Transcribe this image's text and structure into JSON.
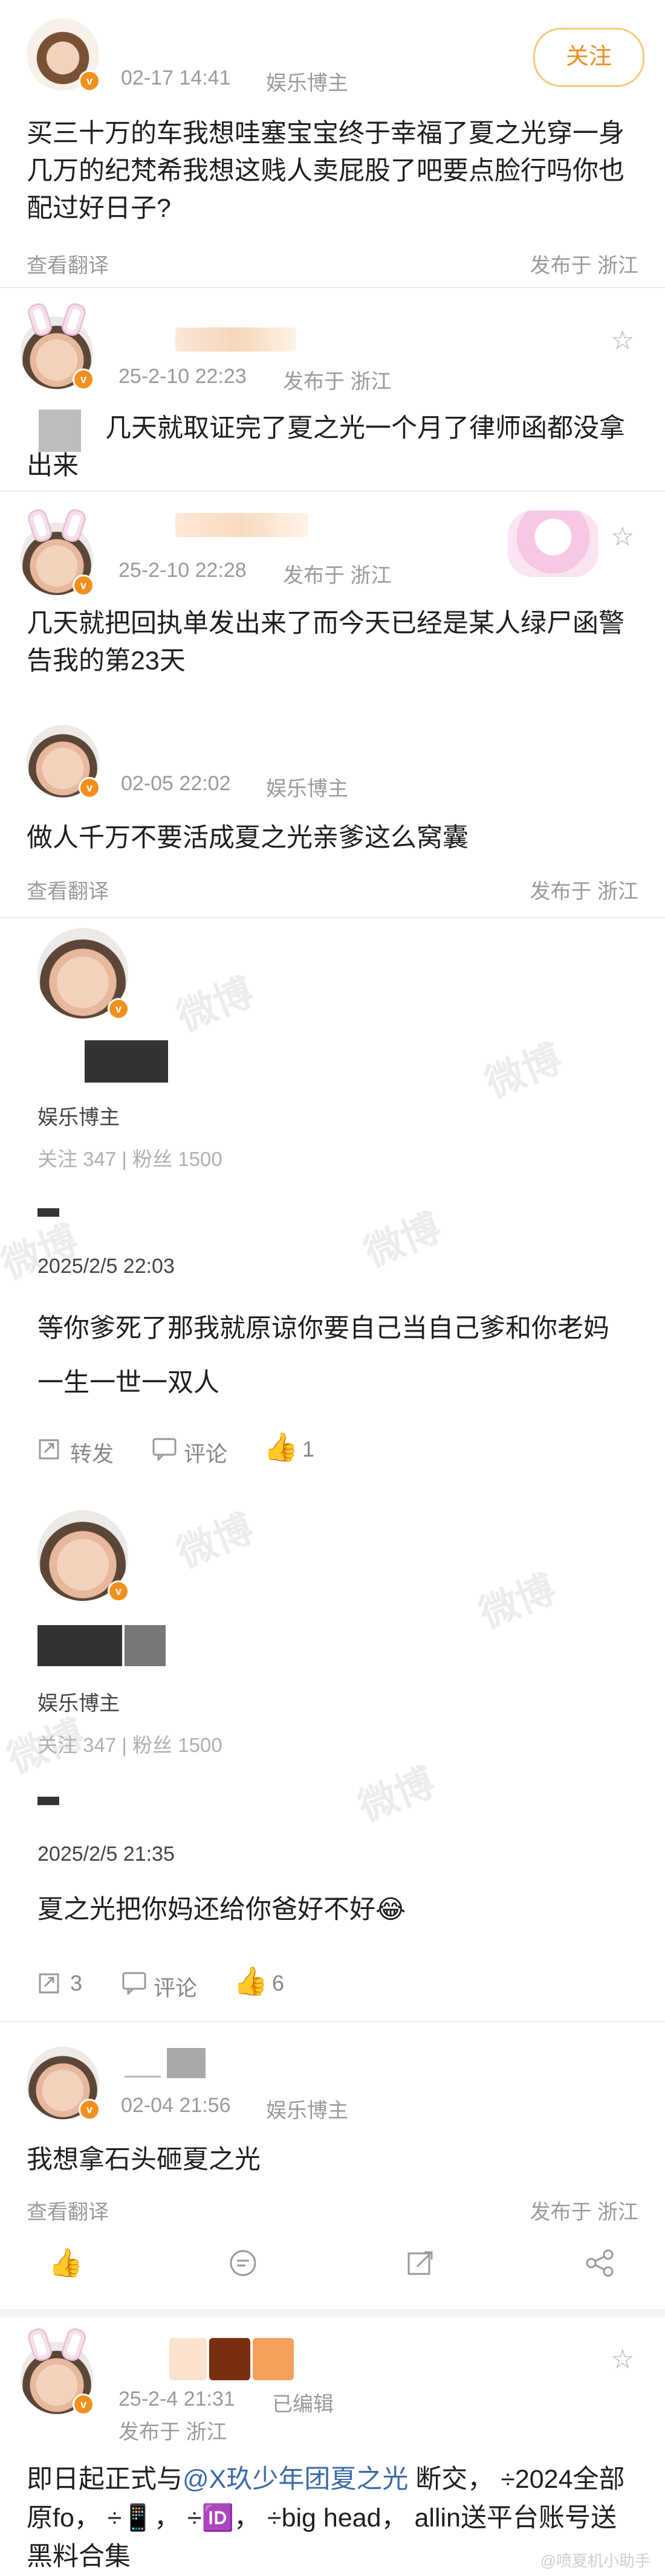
{
  "post1": {
    "time": "02-17 14:41",
    "tag": "娱乐博主",
    "follow_label": "关注",
    "text": "买三十万的车我想哇塞宝宝终于幸福了夏之光穿一身几万的纪梵希我想这贱人卖屁股了吧要点脸行吗你也配过好日子?",
    "translate": "查看翻译",
    "location": "发布于 浙江"
  },
  "reply1": {
    "time": "25-2-10 22:23",
    "location": "发布于 浙江",
    "text": "几天就取证完了夏之光一个月了律师函都没拿出来"
  },
  "reply2": {
    "time": "25-2-10 22:28",
    "location": "发布于 浙江",
    "text": "几天就把回执单发出来了而今天已经是某人绿尸函警告我的第23天"
  },
  "post2": {
    "time": "02-05 22:02",
    "tag": "娱乐博主",
    "text": "做人千万不要活成夏之光亲爹这么窝囊",
    "translate": "查看翻译",
    "location": "发布于 浙江"
  },
  "profile1": {
    "tag": "娱乐博主",
    "stats": "关注 347 | 粉丝 1500",
    "date": "2025/2/5 22:03",
    "text": "等你爹死了那我就原谅你要自己当自己爹和你老妈一生一世一双人",
    "repost": "转发",
    "comment": "评论",
    "likes": "1"
  },
  "profile2": {
    "tag": "娱乐博主",
    "stats": "关注 347 | 粉丝 1500",
    "date": "2025/2/5 21:35",
    "text": "夏之光把你妈还给你爸好不好😂",
    "reposts": "3",
    "comment": "评论",
    "likes": "6"
  },
  "post3": {
    "time": "02-04 21:56",
    "tag": "娱乐博主",
    "text": "我想拿石头砸夏之光",
    "translate": "查看翻译",
    "location": "发布于 浙江"
  },
  "post4": {
    "time": "25-2-4 21:31",
    "edited": "已编辑",
    "location": "发布于 浙江",
    "text_a": "即日起正式与",
    "mention": "@X玖少年团夏之光",
    "text_b": "断交，  ÷2024全部原fo，  ÷📱，  ÷🆔，  ÷big head，  allin送平台账号送黑料合集",
    "watermark": "@喷夏机小助手"
  },
  "watermark_text": "微博",
  "colors": {
    "accent": "#ef8f1a",
    "verify": "#f2901e",
    "mention": "#3c6aa8",
    "gray": "#9a9a9a"
  }
}
